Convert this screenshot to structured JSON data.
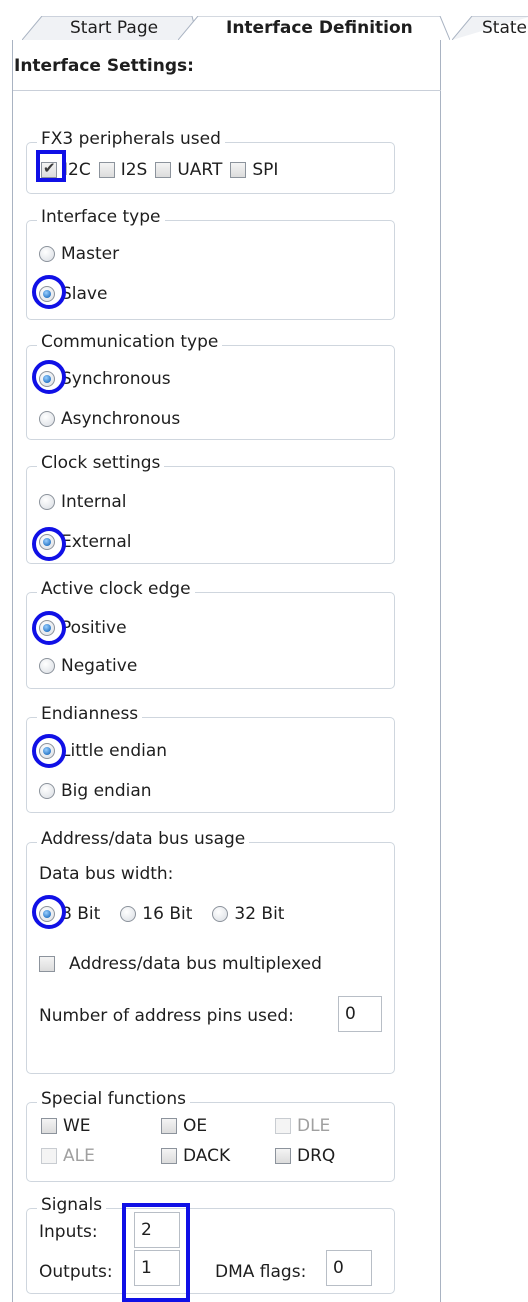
{
  "tabs": [
    {
      "label": "Start Page",
      "active": false
    },
    {
      "label": "Interface Definition",
      "active": true
    },
    {
      "label": "State",
      "active": false
    }
  ],
  "panel": {
    "title": "Interface Settings:"
  },
  "peripherals": {
    "legend": "FX3 peripherals used",
    "items": [
      {
        "label": "I2C",
        "checked": true
      },
      {
        "label": "I2S",
        "checked": false
      },
      {
        "label": "UART",
        "checked": false
      },
      {
        "label": "SPI",
        "checked": false
      }
    ]
  },
  "interface_type": {
    "legend": "Interface type",
    "options": [
      "Master",
      "Slave"
    ],
    "selected": "Slave"
  },
  "communication_type": {
    "legend": "Communication type",
    "options": [
      "Synchronous",
      "Asynchronous"
    ],
    "selected": "Synchronous"
  },
  "clock_settings": {
    "legend": "Clock settings",
    "options": [
      "Internal",
      "External"
    ],
    "selected": "External"
  },
  "clock_edge": {
    "legend": "Active clock edge",
    "options": [
      "Positive",
      "Negative"
    ],
    "selected": "Positive"
  },
  "endianness": {
    "legend": "Endianness",
    "options": [
      "Little endian",
      "Big endian"
    ],
    "selected": "Little endian"
  },
  "bus": {
    "legend": "Address/data bus usage",
    "width_label": "Data bus width:",
    "widths": [
      "8 Bit",
      "16 Bit",
      "32 Bit"
    ],
    "selected": "8 Bit",
    "multiplexed_label": "Address/data bus multiplexed",
    "multiplexed": false,
    "address_pins_label": "Number of address pins used:",
    "address_pins": "0"
  },
  "special_functions": {
    "legend": "Special functions",
    "items": [
      {
        "label": "WE",
        "checked": false,
        "enabled": true
      },
      {
        "label": "OE",
        "checked": false,
        "enabled": true
      },
      {
        "label": "DLE",
        "checked": false,
        "enabled": false
      },
      {
        "label": "ALE",
        "checked": false,
        "enabled": false
      },
      {
        "label": "DACK",
        "checked": false,
        "enabled": true
      },
      {
        "label": "DRQ",
        "checked": false,
        "enabled": true
      }
    ]
  },
  "signals": {
    "legend": "Signals",
    "inputs_label": "Inputs:",
    "inputs": "2",
    "outputs_label": "Outputs:",
    "outputs": "1",
    "dma_label": "DMA flags:",
    "dma": "0"
  },
  "colors": {
    "highlight": "#1010e6",
    "radio_fill": "#1f6fc2",
    "group_border": "#cfd6de"
  }
}
